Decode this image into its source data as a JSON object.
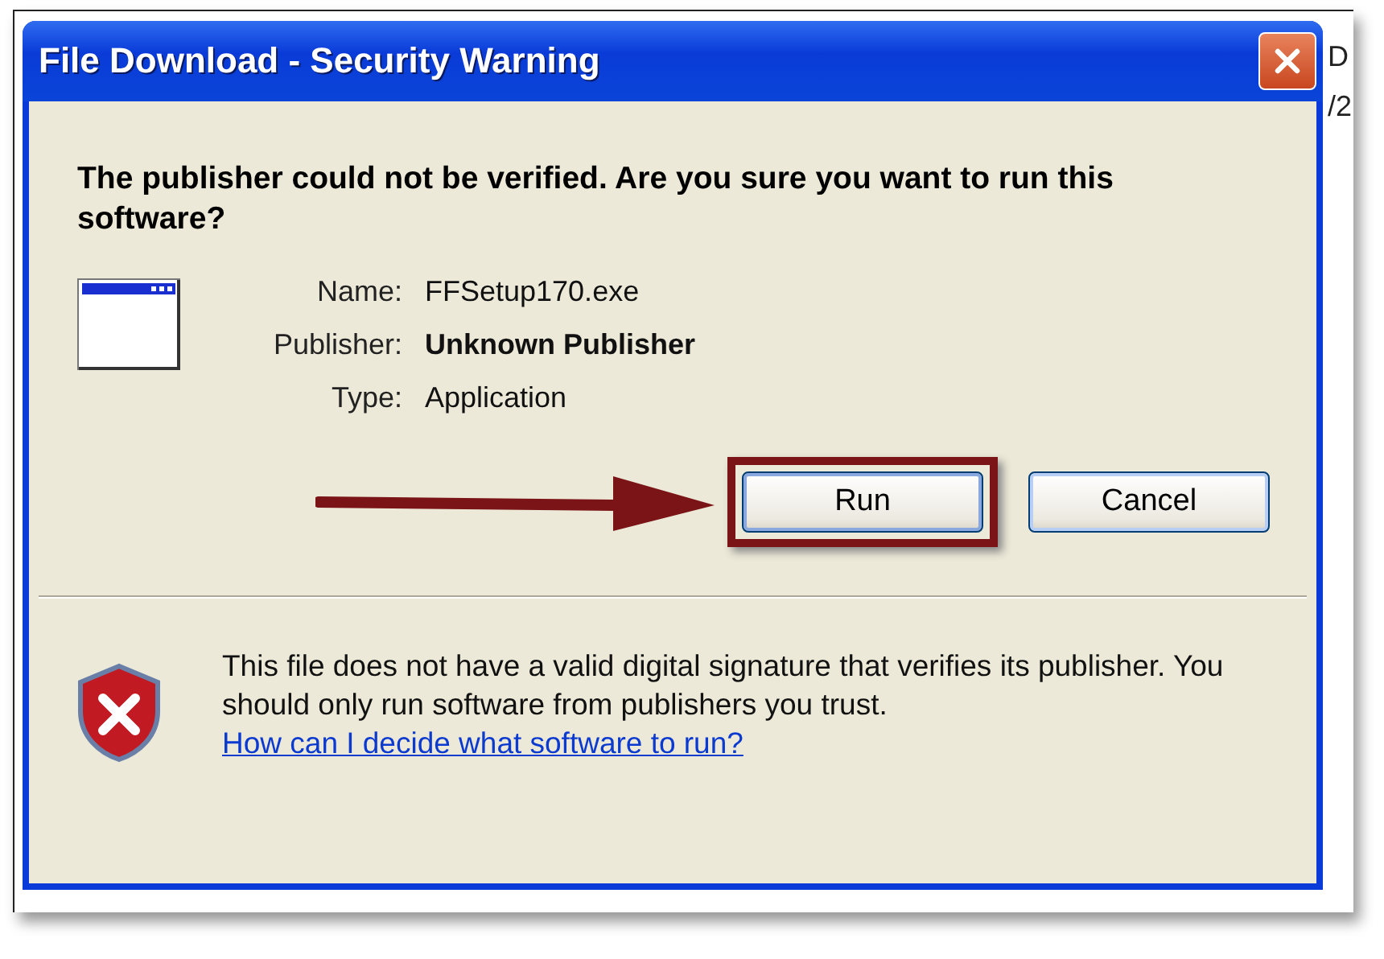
{
  "background_window": {
    "texts": [
      "D",
      "/2"
    ]
  },
  "window": {
    "title": "File Download - Security Warning"
  },
  "headline": "The publisher could not be verified.  Are you sure you want to run this software?",
  "details": [
    {
      "label": "Name:",
      "value": "FFSetup170.exe",
      "bold": false
    },
    {
      "label": "Publisher:",
      "value": "Unknown Publisher",
      "bold": true
    },
    {
      "label": "Type:",
      "value": "Application",
      "bold": false
    }
  ],
  "buttons": [
    {
      "label": "Run",
      "highlighted": true
    },
    {
      "label": "Cancel",
      "highlighted": false
    }
  ],
  "footer": {
    "text": "This file does not have a valid digital signature that verifies its publisher.  You should only run software from publishers you trust.",
    "link": "How can I decide what software to run?"
  }
}
